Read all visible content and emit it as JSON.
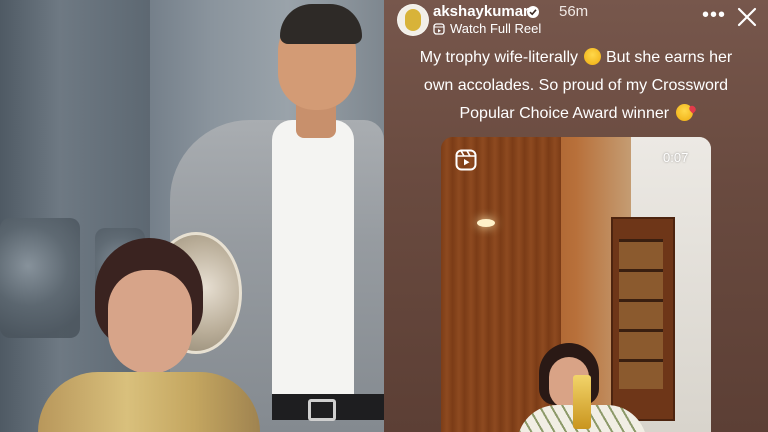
{
  "story": {
    "username": "akshaykumar",
    "time_ago": "56m",
    "reel_link": "Watch Full Reel",
    "caption_lines": [
      "My trophy wife-literally",
      "But she earns her",
      "own accolades. So proud of my Crossword",
      "Popular Choice Award winner"
    ],
    "reel_duration": "0:07"
  },
  "colors": {
    "story_bg": "#6a4b40",
    "text": "#ffffff"
  },
  "icons": {
    "verified": "verified-badge-icon",
    "reel": "reel-icon",
    "more": "more-options-icon",
    "close": "close-icon",
    "laugh": "laughing-emoji",
    "kiss": "kiss-emoji"
  }
}
